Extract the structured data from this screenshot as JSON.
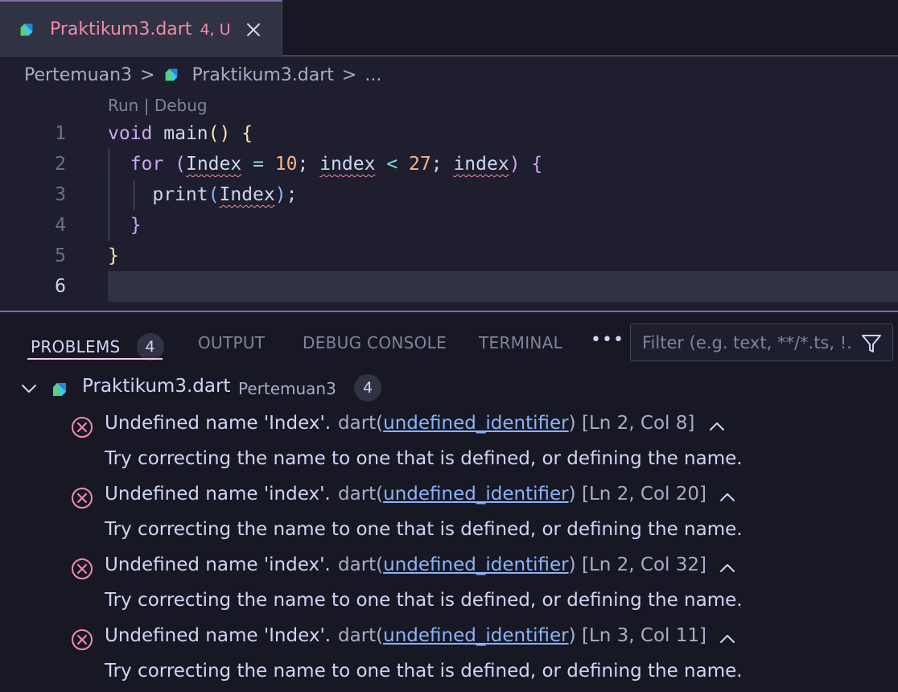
{
  "tab": {
    "title": "Praktikum3.dart",
    "badge": "4, U",
    "file_icon": "dart-icon",
    "close_icon": "close-icon"
  },
  "breadcrumb": {
    "folder": "Pertemuan3",
    "file": "Praktikum3.dart",
    "ellipsis": "...",
    "separator": ">"
  },
  "editor": {
    "codelens": {
      "run": "Run",
      "sep": " | ",
      "debug": "Debug"
    },
    "line_numbers": [
      "1",
      "2",
      "3",
      "4",
      "5",
      "6"
    ],
    "current_line": "6",
    "lines": [
      "void main() {",
      "  for (Index = 10; index < 27; index) {",
      "    print(Index);",
      "  }",
      "}",
      ""
    ]
  },
  "panel": {
    "tabs": [
      "PROBLEMS",
      "OUTPUT",
      "DEBUG CONSOLE",
      "TERMINAL"
    ],
    "problems_count": "4",
    "more": "•••",
    "filter_placeholder": "Filter (e.g. text, **/*.ts, !..."
  },
  "problems": {
    "file": "Praktikum3.dart",
    "folder": "Pertemuan3",
    "count": "4",
    "items": [
      {
        "message": "Undefined name 'Index'.",
        "source": "dart",
        "code": "undefined_identifier",
        "position": "[Ln 2, Col 8]",
        "hint": "Try correcting the name to one that is defined, or defining the name."
      },
      {
        "message": "Undefined name 'index'.",
        "source": "dart",
        "code": "undefined_identifier",
        "position": "[Ln 2, Col 20]",
        "hint": "Try correcting the name to one that is defined, or defining the name."
      },
      {
        "message": "Undefined name 'index'.",
        "source": "dart",
        "code": "undefined_identifier",
        "position": "[Ln 2, Col 32]",
        "hint": "Try correcting the name to one that is defined, or defining the name."
      },
      {
        "message": "Undefined name 'Index'.",
        "source": "dart",
        "code": "undefined_identifier",
        "position": "[Ln 3, Col 11]",
        "hint": "Try correcting the name to one that is defined, or defining the name."
      }
    ]
  },
  "colors": {
    "accent": "#7f6aa8",
    "error": "#f38ba8",
    "link": "#89b4fa",
    "tab_active_underline": "#f5c2e7"
  }
}
